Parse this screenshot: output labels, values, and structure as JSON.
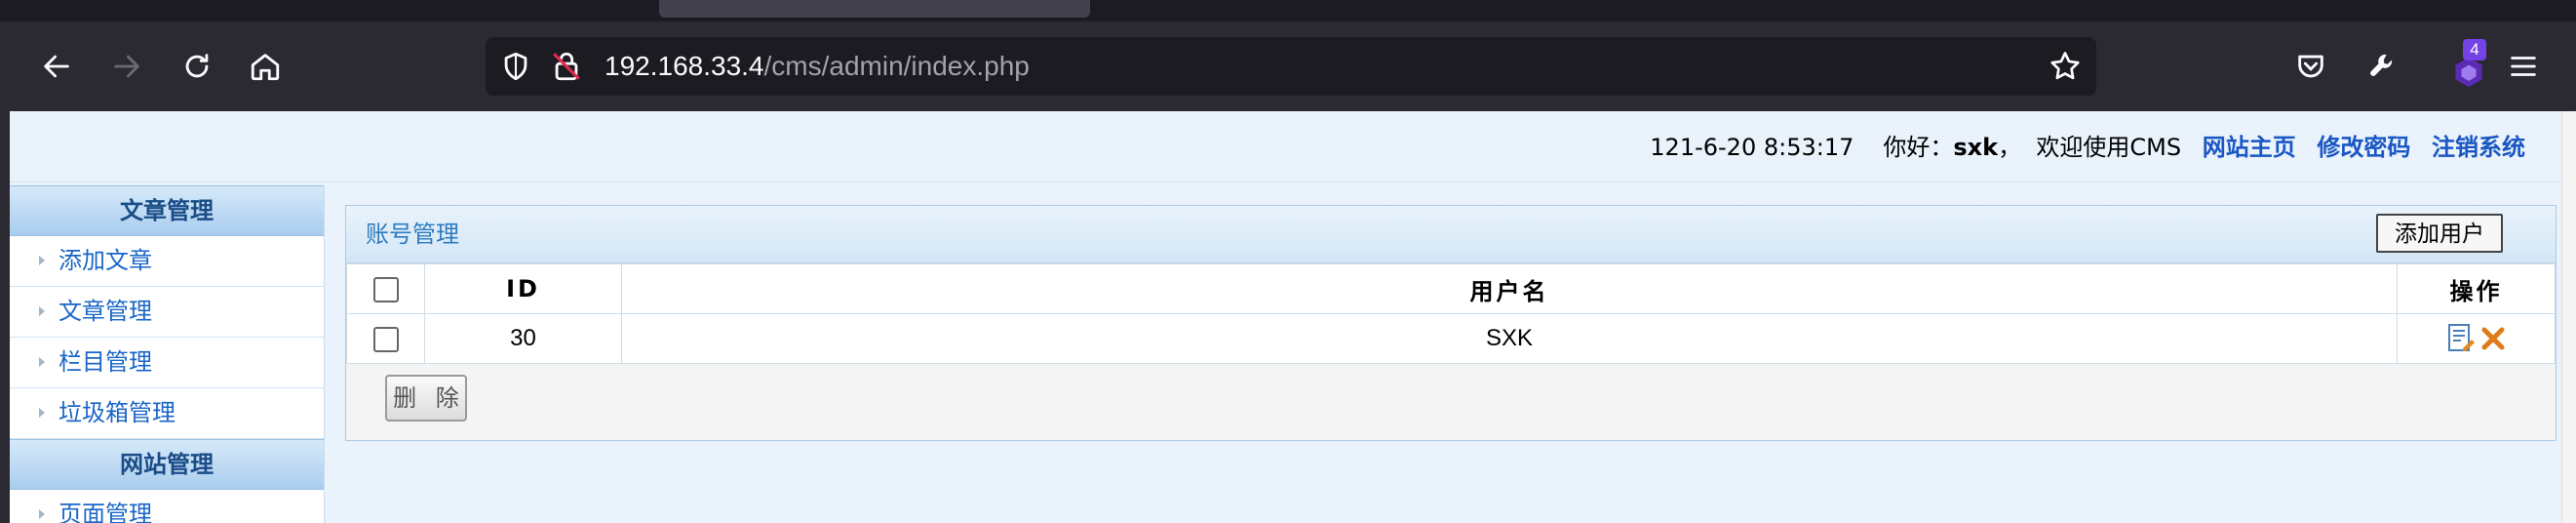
{
  "browser": {
    "url_host": "192.168.33.4",
    "url_path": "/cms/admin/index.php",
    "extension_badge": "4"
  },
  "header": {
    "datetime": "121-6-20 8:53:17",
    "greeting": "你好：",
    "username": "sxk",
    "welcome": "，  欢迎使用CMS",
    "links": [
      "网站主页",
      "修改密码",
      "注销系统"
    ]
  },
  "sidebar": {
    "sections": [
      {
        "title": "文章管理",
        "items": [
          "添加文章",
          "文章管理",
          "栏目管理",
          "垃圾箱管理"
        ]
      },
      {
        "title": "网站管理",
        "items": [
          "页面管理"
        ]
      }
    ]
  },
  "panel": {
    "title": "账号管理",
    "add_button": "添加用户",
    "columns": [
      "ID",
      "用户名",
      "操作"
    ],
    "rows": [
      {
        "id": "30",
        "username": "SXK"
      }
    ],
    "delete_button": "删 除"
  },
  "colors": {
    "link": "#1a56c4",
    "sidebar_header": "#a9cdee",
    "panel_title": "#2d7bc0"
  }
}
